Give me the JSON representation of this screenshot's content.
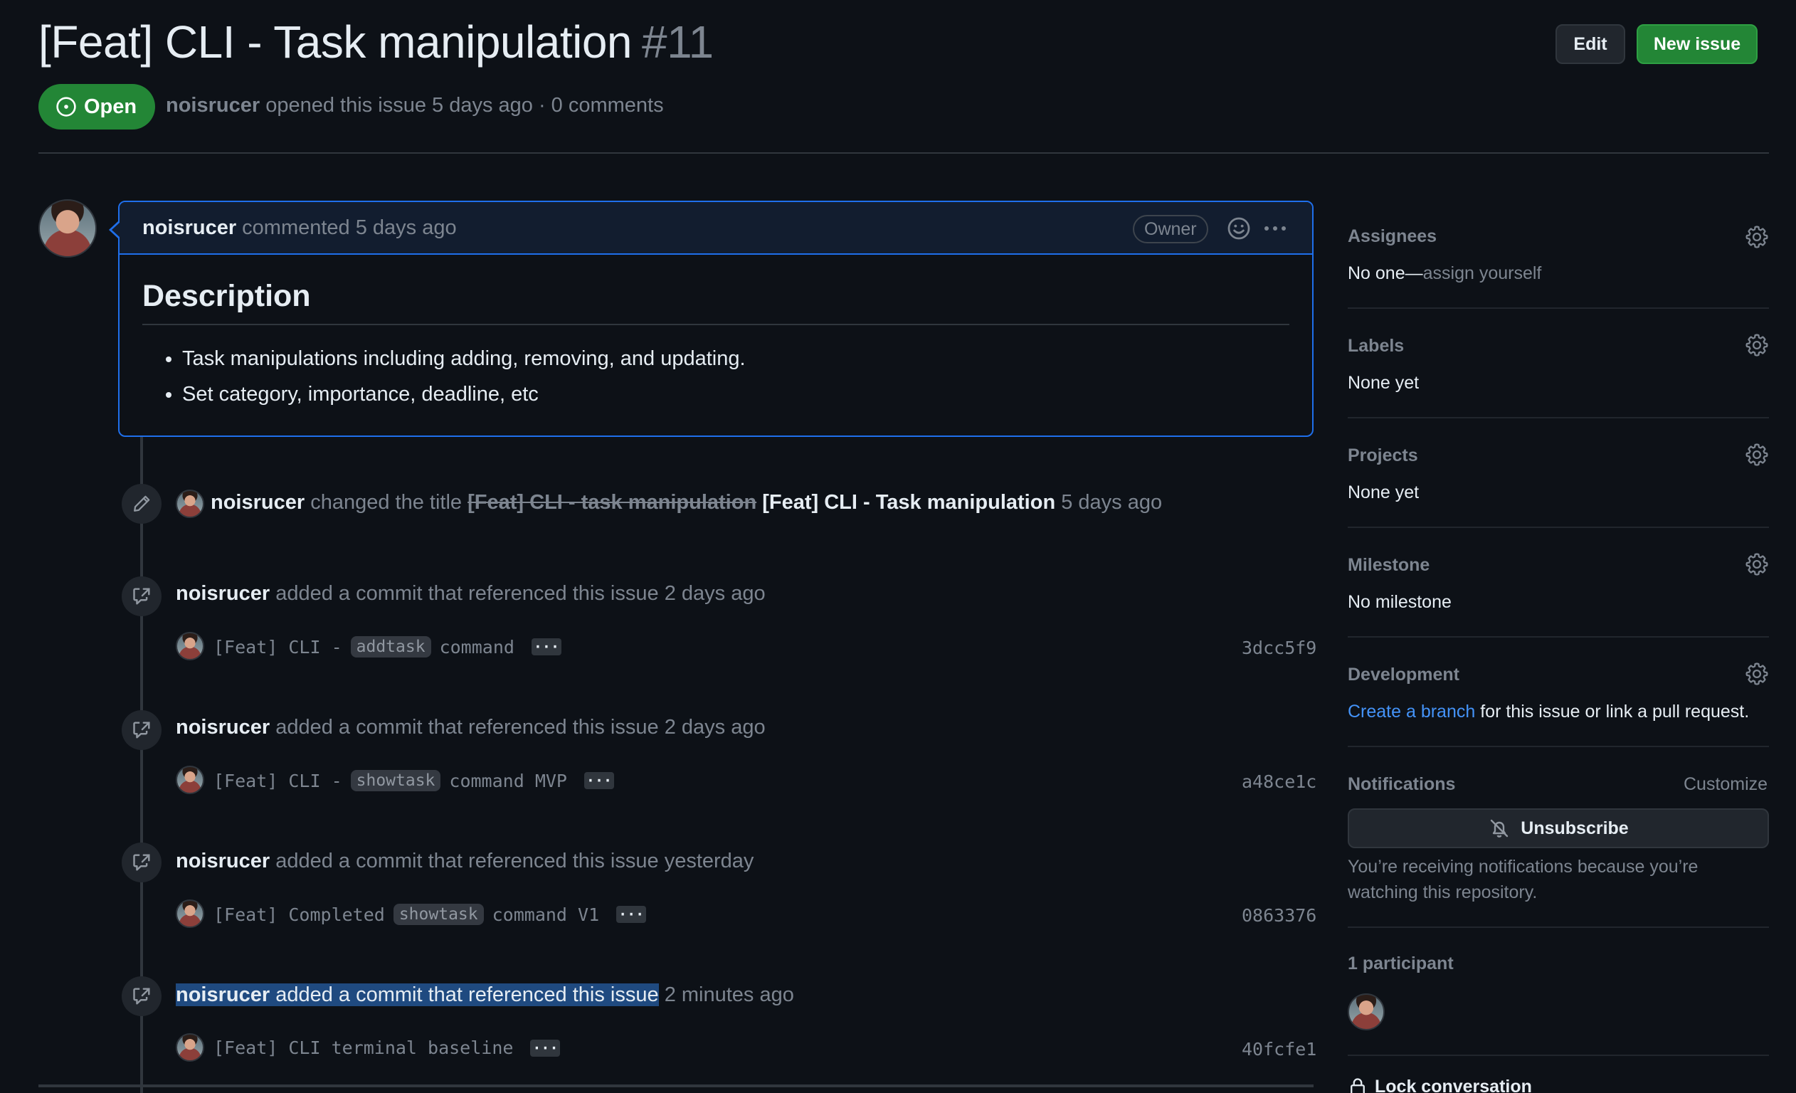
{
  "issue": {
    "title": "[Feat] CLI - Task manipulation",
    "number": "#11",
    "state": "Open",
    "author": "noisrucer",
    "opened_text": "opened this issue 5 days ago · 0 comments"
  },
  "header": {
    "edit_label": "Edit",
    "new_issue_label": "New issue"
  },
  "comment": {
    "author": "noisrucer",
    "meta": "commented 5 days ago",
    "role_badge": "Owner",
    "heading": "Description",
    "bullets": [
      "Task manipulations including adding, removing, and updating.",
      "Set category, importance, deadline, etc"
    ]
  },
  "timeline": {
    "rename": {
      "author": "noisrucer",
      "action": "changed the title",
      "old_title": "[Feat] CLI - task manipulation",
      "new_title": "[Feat] CLI - Task manipulation",
      "time": "5 days ago"
    },
    "commits": [
      {
        "author": "noisrucer",
        "action": "added a commit that referenced this issue",
        "time": "2 days ago",
        "msg_before": "[Feat] CLI -",
        "code": "addtask",
        "msg_after": "command",
        "sha": "3dcc5f9"
      },
      {
        "author": "noisrucer",
        "action": "added a commit that referenced this issue",
        "time": "2 days ago",
        "msg_before": "[Feat] CLI -",
        "code": "showtask",
        "msg_after": "command MVP",
        "sha": "a48ce1c"
      },
      {
        "author": "noisrucer",
        "action": "added a commit that referenced this issue",
        "time": "yesterday",
        "msg_before": "[Feat] Completed",
        "code": "showtask",
        "msg_after": "command V1",
        "sha": "0863376"
      },
      {
        "author": "noisrucer",
        "action": "added a commit that referenced this issue",
        "time": "2 minutes ago",
        "msg_before": "[Feat] CLI terminal baseline",
        "code": "",
        "msg_after": "",
        "sha": "40fcfe1"
      }
    ],
    "ellipsis": "···"
  },
  "sidebar": {
    "assignees": {
      "label": "Assignees",
      "value_prefix": "No one—",
      "value_link": "assign yourself"
    },
    "labels": {
      "label": "Labels",
      "value": "None yet"
    },
    "projects": {
      "label": "Projects",
      "value": "None yet"
    },
    "milestone": {
      "label": "Milestone",
      "value": "No milestone"
    },
    "development": {
      "label": "Development",
      "link": "Create a branch",
      "rest": "for this issue or link a pull request."
    },
    "notifications": {
      "label": "Notifications",
      "customize": "Customize",
      "button": "Unsubscribe",
      "reason": "You’re receiving notifications because you’re watching this repository."
    },
    "participants": "1 participant",
    "lock": "Lock conversation"
  },
  "colors": {
    "background": "#0d1117",
    "accent_blue": "#1f6feb",
    "open_green": "#238636",
    "link_blue": "#4493f8"
  },
  "icons": [
    "issue-opened-icon",
    "smiley-icon",
    "kebab-icon",
    "pencil-icon",
    "cross-reference-icon",
    "gear-icon",
    "bell-slash-icon",
    "lock-icon"
  ]
}
